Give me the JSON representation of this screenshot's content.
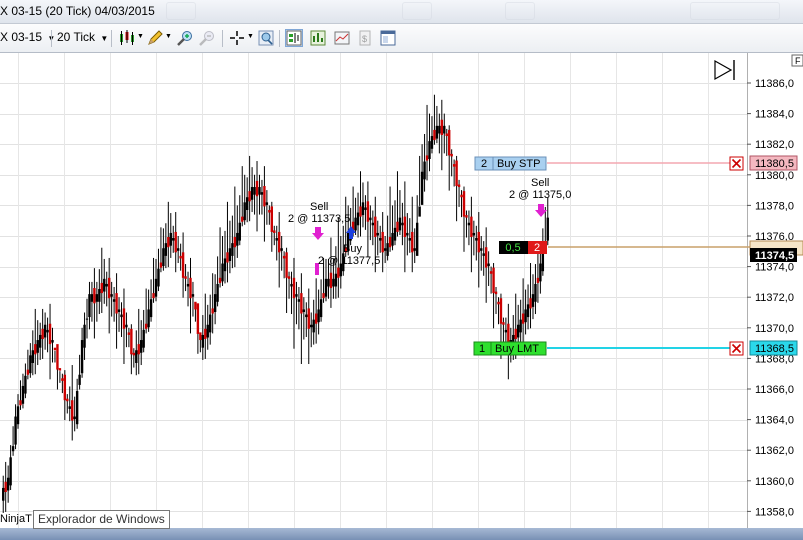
{
  "window": {
    "title": "X 03-15 (20 Tick)  04/03/2015"
  },
  "toolbar": {
    "instrument": "X 03-15",
    "interval": "20 Tick",
    "icons": [
      "candlestick-style-icon",
      "pencil-draw-icon",
      "zoom-in-icon",
      "zoom-out-icon",
      "crosshair-icon",
      "magnify-icon",
      "chart-trader-icon",
      "strategy-icon",
      "chart-properties-icon",
      "data-box-icon",
      "window-layout-icon"
    ]
  },
  "chart": {
    "price_labels": [
      "11386,0",
      "11384,0",
      "11382,0",
      "11380,0",
      "11378,0",
      "11376,0",
      "11374,0",
      "11372,0",
      "11370,0",
      "11368,0",
      "11366,0",
      "11364,0",
      "11362,0",
      "11360,0",
      "11358,0"
    ],
    "f_label": "F",
    "executions": [
      {
        "side": "Sell",
        "text": "2 @ 11373,5"
      },
      {
        "side": "Buy",
        "text": "2 @ 11377,5"
      },
      {
        "side": "Sell",
        "text": "2 @ 11375,0"
      }
    ],
    "orders": {
      "buy_stop": {
        "qty": "2",
        "label": "Buy STP",
        "price": "11380,5",
        "color": "#f4a7b1"
      },
      "buy_limit": {
        "qty": "1",
        "label": "Buy LMT",
        "price": "11368,5",
        "color": "#22d3e6"
      },
      "position": {
        "pnl": "0,5",
        "qty": "2",
        "price": "11374,5",
        "line_color": "#c8a06a"
      }
    }
  },
  "chart_data": {
    "type": "candlestick",
    "ylim": [
      11357,
      11387
    ],
    "up_color": "#000000",
    "down_color": "#cc0000",
    "price_tick_labels": [
      "11386,0",
      "11384,0",
      "11382,0",
      "11380,0",
      "11378,0",
      "11376,0",
      "11374,0",
      "11372,0",
      "11370,0",
      "11368,0",
      "11366,0",
      "11364,0",
      "11362,0",
      "11360,0",
      "11358,0"
    ],
    "closes": [
      11360,
      11364,
      11366,
      11368,
      11369,
      11370,
      11369,
      11367,
      11365,
      11364,
      11369,
      11372,
      11372,
      11373,
      11372,
      11371,
      11370,
      11368,
      11369,
      11371,
      11373,
      11375,
      11376,
      11375,
      11373,
      11372,
      11369,
      11370,
      11372,
      11374,
      11375,
      11376,
      11378,
      11379,
      11379,
      11378,
      11376,
      11375,
      11373,
      11372,
      11371,
      11370,
      11371,
      11373,
      11373,
      11374,
      11376,
      11377,
      11378,
      11377,
      11376,
      11375,
      11376,
      11377,
      11376,
      11375,
      11380,
      11382,
      11383,
      11383,
      11381,
      11379,
      11377,
      11376,
      11375,
      11374,
      11372,
      11370,
      11369,
      11370,
      11371,
      11372,
      11374,
      11377
    ],
    "highs": [
      11361,
      11365,
      11367,
      11369,
      11371,
      11371,
      11371,
      11368,
      11367,
      11367,
      11370,
      11373,
      11373,
      11375,
      11374,
      11373,
      11372,
      11370,
      11371,
      11373,
      11375,
      11377,
      11378,
      11377,
      11376,
      11374,
      11371,
      11372,
      11374,
      11377,
      11378,
      11379,
      11381,
      11381,
      11380,
      11380,
      11378,
      11377,
      11375,
      11374,
      11373,
      11372,
      11373,
      11375,
      11375,
      11377,
      11379,
      11379,
      11380,
      11379,
      11378,
      11377,
      11379,
      11380,
      11379,
      11378,
      11383,
      11385,
      11385,
      11384,
      11383,
      11381,
      11379,
      11378,
      11377,
      11376,
      11374,
      11372,
      11371,
      11372,
      11373,
      11374,
      11376,
      11379
    ],
    "lows": [
      11358,
      11360,
      11364,
      11366,
      11367,
      11368,
      11367,
      11366,
      11364,
      11363,
      11364,
      11368,
      11370,
      11371,
      11370,
      11369,
      11368,
      11367,
      11367,
      11369,
      11371,
      11373,
      11374,
      11374,
      11372,
      11370,
      11368,
      11368,
      11369,
      11372,
      11373,
      11374,
      11376,
      11377,
      11377,
      11376,
      11375,
      11373,
      11371,
      11369,
      11368,
      11368,
      11369,
      11371,
      11372,
      11372,
      11374,
      11376,
      11376,
      11375,
      11374,
      11374,
      11375,
      11376,
      11374,
      11374,
      11376,
      11379,
      11382,
      11381,
      11379,
      11377,
      11375,
      11374,
      11373,
      11372,
      11370,
      11368,
      11367,
      11368,
      11369,
      11370,
      11371,
      11374
    ]
  }
}
